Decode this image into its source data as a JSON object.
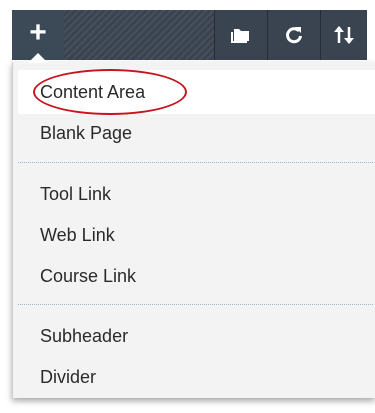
{
  "toolbar": {
    "add_icon": "plus-icon",
    "add_glyph": "+",
    "folder_icon": "folder-icon",
    "refresh_icon": "refresh-icon",
    "sort_icon": "sort-icon"
  },
  "menu": {
    "items": [
      {
        "label": "Content Area",
        "annotated": true
      },
      {
        "label": "Blank Page"
      },
      {
        "label": "Tool Link"
      },
      {
        "label": "Web Link"
      },
      {
        "label": "Course Link"
      },
      {
        "label": "Subheader"
      },
      {
        "label": "Divider"
      }
    ]
  },
  "colors": {
    "toolbar_bg": "#2e3640",
    "menu_bg": "#f3f3f3",
    "annotation_circle": "#c8141e",
    "divider": "#9fb4cc"
  }
}
